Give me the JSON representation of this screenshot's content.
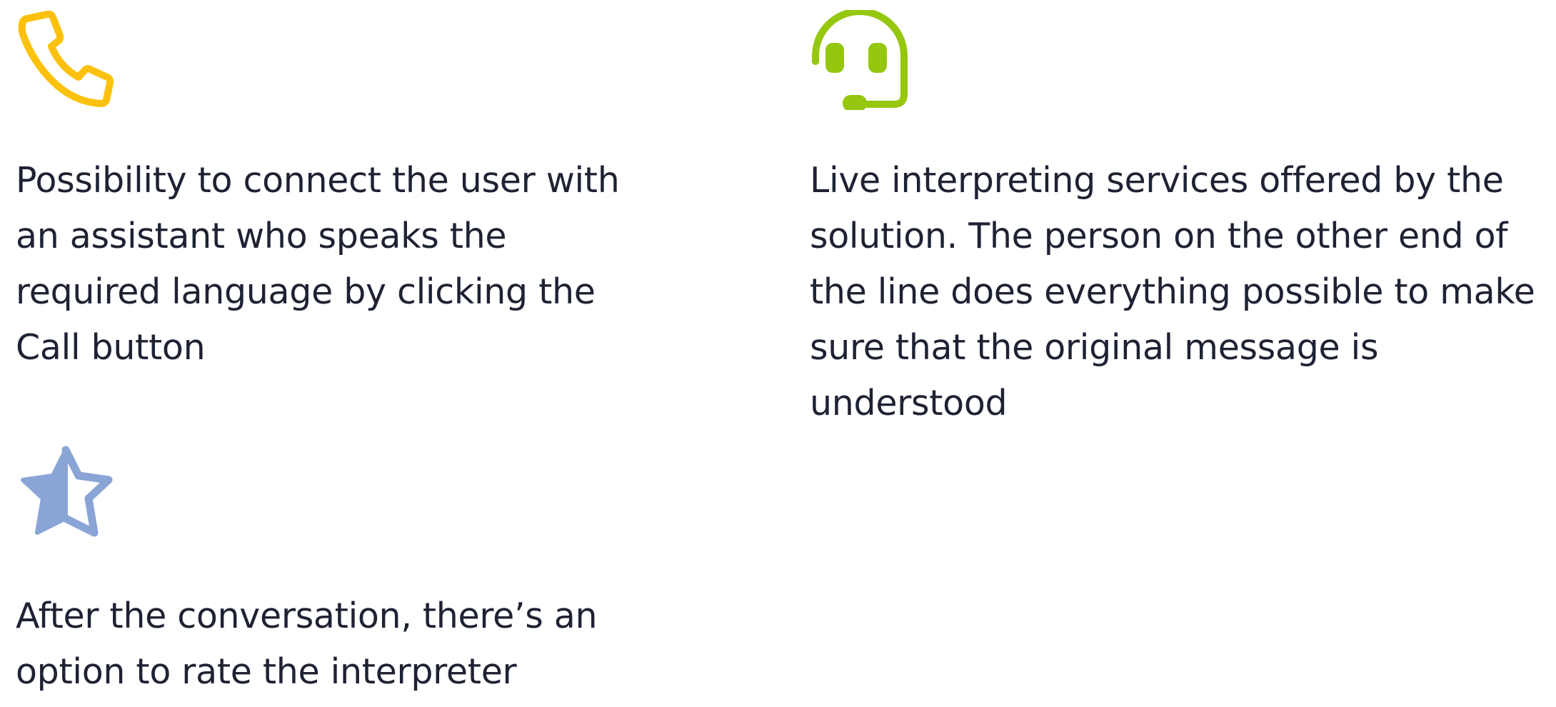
{
  "colors": {
    "phone_icon": "#fcc10c",
    "headset_icon": "#95c70e",
    "star_icon": "#8aa4d6",
    "text": "#1e2233",
    "background": "#ffffff"
  },
  "features": {
    "call": {
      "icon": "phone-icon",
      "text": "Possibility to connect the user with an assistant who speaks the required language by clicking the Call button"
    },
    "live": {
      "icon": "headset-icon",
      "text": "Live interpreting services offered by the solution. The person on the other end of the line does everything possible to make sure that the original message is understood"
    },
    "rate": {
      "icon": "half-star-icon",
      "text": "After the conversation, there’s an option to rate the interpreter"
    }
  }
}
